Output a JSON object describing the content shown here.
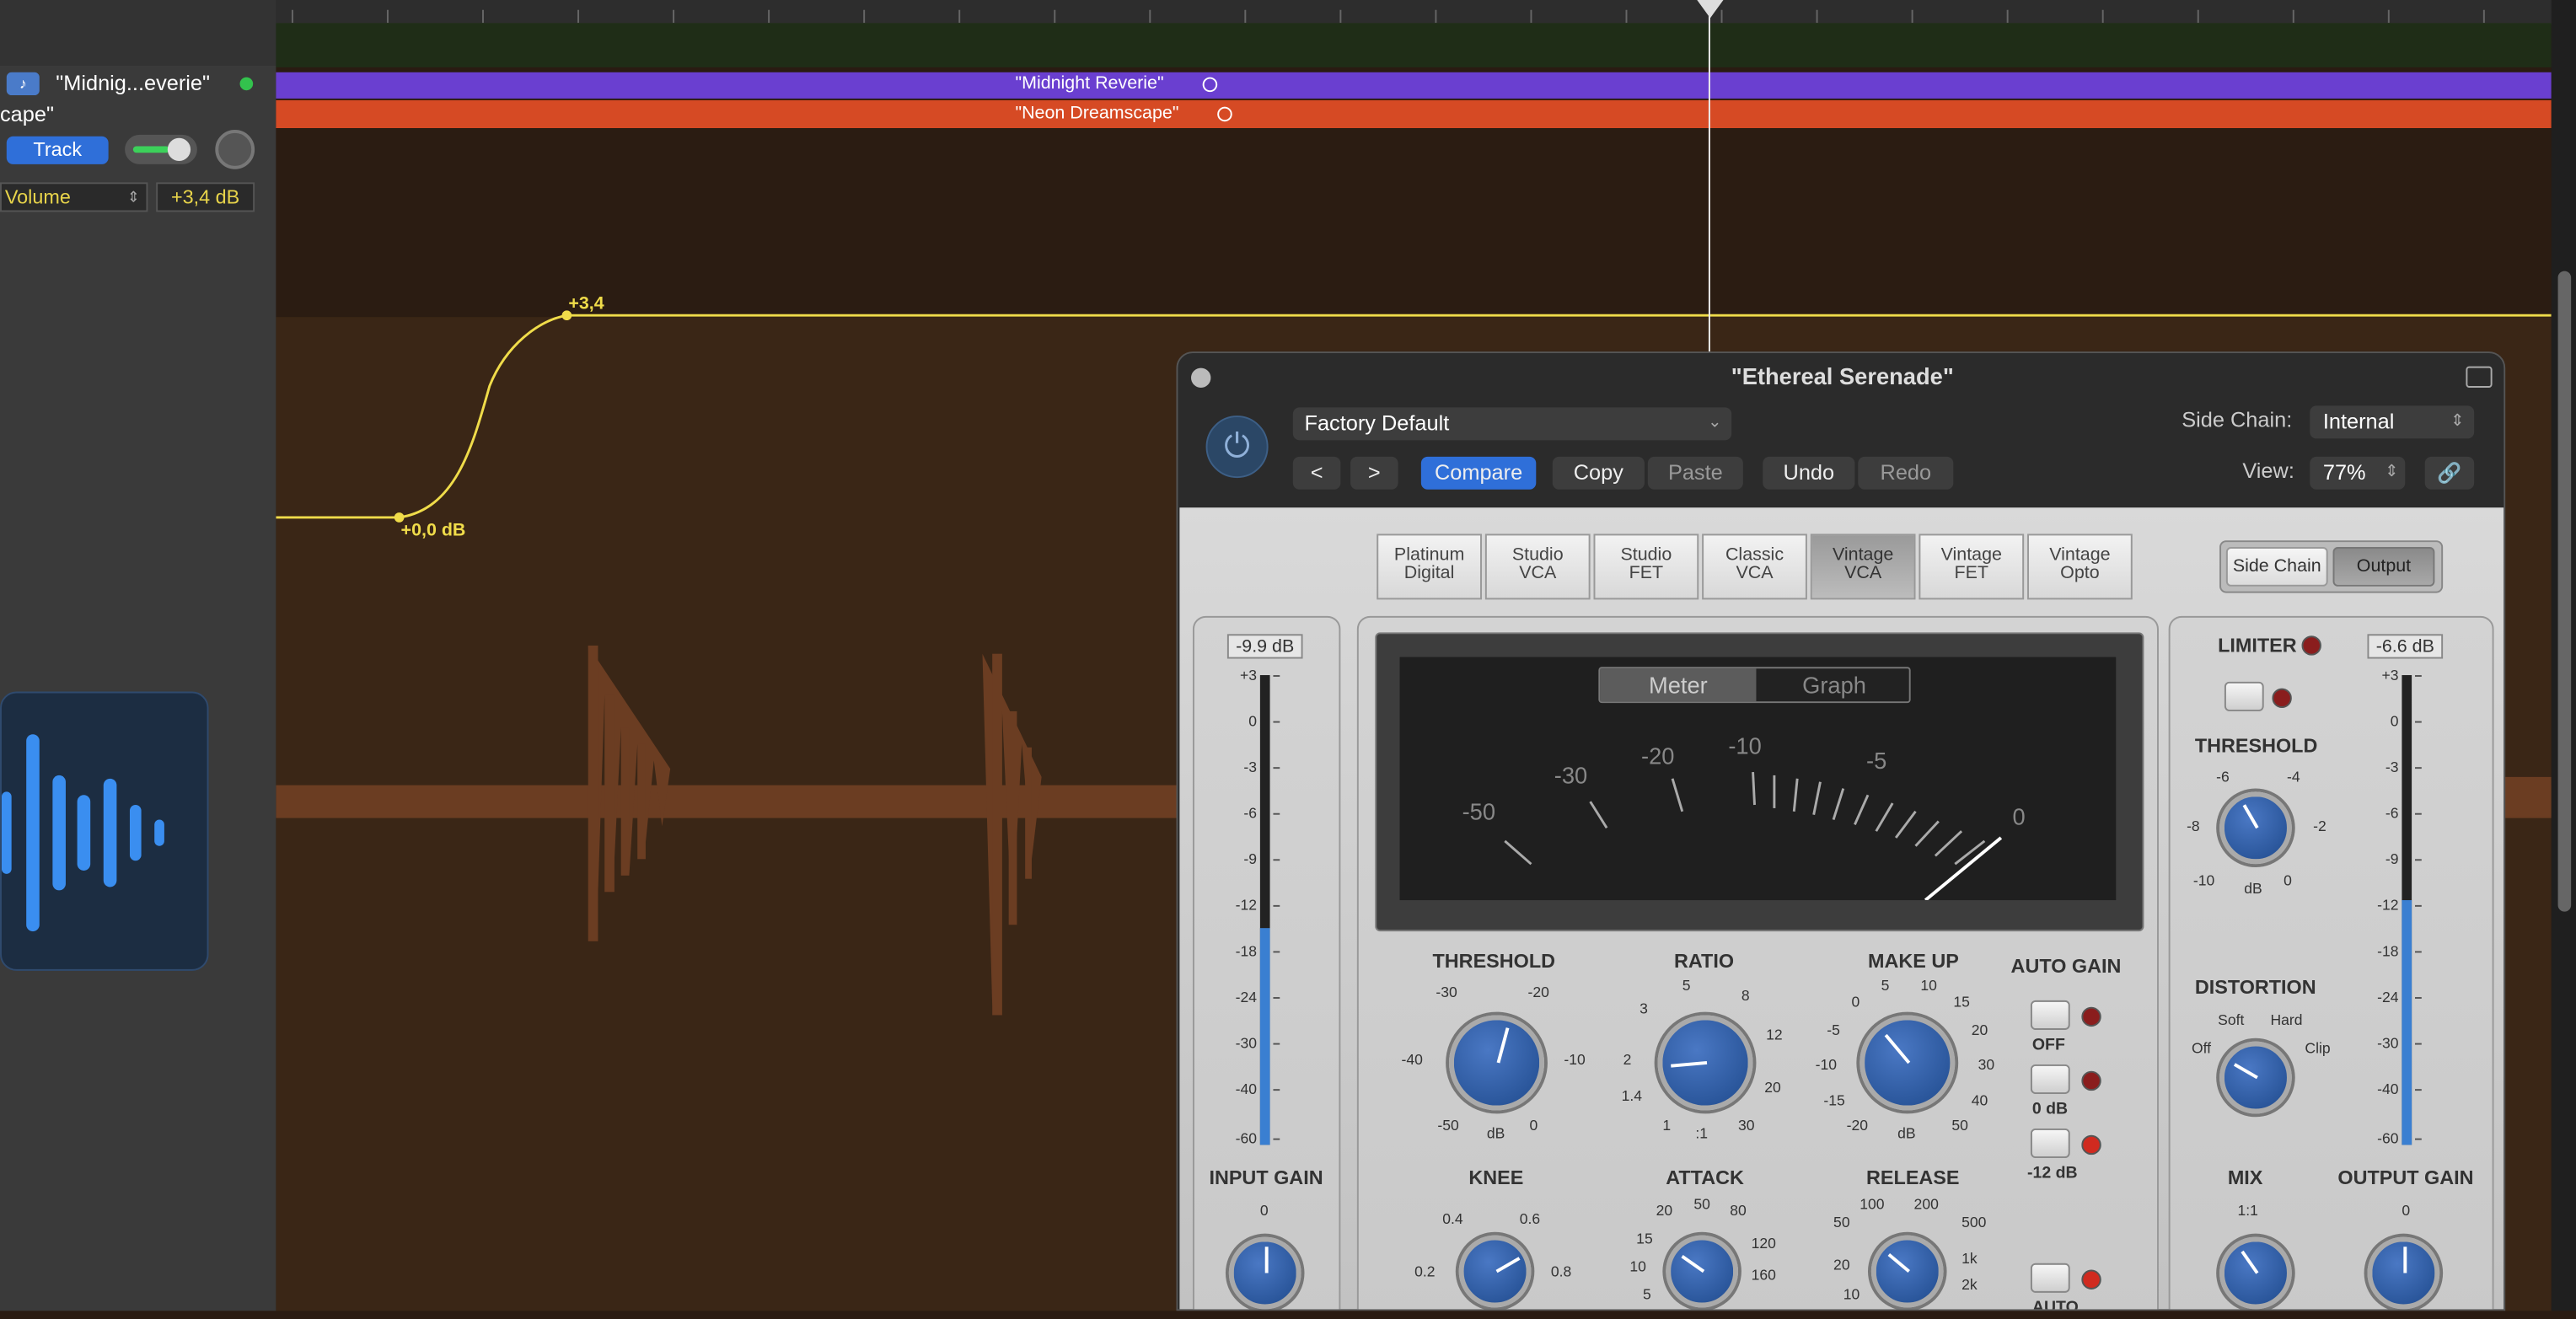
{
  "track": {
    "name": "\"Midnig...everie\"",
    "name2": "cape\"",
    "icon": "midi-track-icon",
    "track_btn": "Track",
    "automation_param": "Volume",
    "automation_value": "+3,4 dB"
  },
  "regions": [
    {
      "label": "\"Midnight Reverie\"",
      "color": "#6a3fd0"
    },
    {
      "label": "\"Neon Dreamscape\"",
      "color": "#d64a24"
    }
  ],
  "automation": {
    "start_label": "+0,0 dB",
    "end_label": "+3,4"
  },
  "plugin": {
    "title": "\"Ethereal Serenade\"",
    "preset": "Factory Default",
    "side_chain_label": "Side Chain:",
    "side_chain_value": "Internal",
    "view_label": "View:",
    "view_value": "77%",
    "buttons": {
      "compare": "Compare",
      "copy": "Copy",
      "paste": "Paste",
      "undo": "Undo",
      "redo": "Redo"
    },
    "models": [
      {
        "l1": "Platinum",
        "l2": "Digital"
      },
      {
        "l1": "Studio",
        "l2": "VCA"
      },
      {
        "l1": "Studio",
        "l2": "FET"
      },
      {
        "l1": "Classic",
        "l2": "VCA"
      },
      {
        "l1": "Vintage",
        "l2": "VCA"
      },
      {
        "l1": "Vintage",
        "l2": "FET"
      },
      {
        "l1": "Vintage",
        "l2": "Opto"
      }
    ],
    "selected_model": 4,
    "right_tabs": {
      "side_chain": "Side Chain",
      "output": "Output"
    },
    "meter_tabs": {
      "meter": "Meter",
      "graph": "Graph"
    },
    "vu_scale": [
      "-50",
      "-30",
      "-20",
      "-10",
      "-5",
      "0"
    ],
    "input": {
      "db": "-9.9 dB",
      "label": "INPUT GAIN",
      "zero": "0",
      "level": 0.46
    },
    "output": {
      "db": "-6.6 dB",
      "label": "OUTPUT GAIN",
      "zero": "0",
      "level": 0.52
    },
    "meter_scale": [
      "+3",
      "0",
      "-3",
      "-6",
      "-9",
      "-12",
      "-18",
      "-24",
      "-30",
      "-40",
      "-60"
    ],
    "threshold": {
      "label": "THRESHOLD",
      "ticks": [
        "-30",
        "-20",
        "-40",
        "-10",
        "-50",
        "0"
      ],
      "unit": "dB"
    },
    "ratio": {
      "label": "RATIO",
      "ticks": [
        "5",
        "3",
        "8",
        "2",
        "12",
        "1.4",
        "20",
        "1",
        "30"
      ],
      "unit": ":1"
    },
    "makeup": {
      "label": "MAKE UP",
      "ticks": [
        "5",
        "10",
        "0",
        "15",
        "-5",
        "20",
        "-10",
        "30",
        "-15",
        "40",
        "-20",
        "50"
      ],
      "unit": "dB"
    },
    "auto_gain": {
      "label": "AUTO GAIN",
      "off": "OFF",
      "zero": "0 dB",
      "minus12": "-12 dB",
      "auto": "AUTO"
    },
    "knee": {
      "label": "KNEE",
      "ticks": [
        "0.4",
        "0.6",
        "0.2",
        "0.8"
      ]
    },
    "attack": {
      "label": "ATTACK",
      "ticks": [
        "20",
        "50",
        "80",
        "15",
        "120",
        "10",
        "160",
        "5"
      ]
    },
    "release": {
      "label": "RELEASE",
      "ticks": [
        "100",
        "200",
        "50",
        "500",
        "20",
        "1k",
        "10",
        "2k"
      ]
    },
    "limiter": {
      "label": "LIMITER",
      "threshold": "THRESHOLD",
      "ticks": [
        "-6",
        "-4",
        "-8",
        "-2",
        "-10",
        "0"
      ],
      "unit": "dB"
    },
    "distortion": {
      "label": "DISTORTION",
      "soft": "Soft",
      "hard": "Hard",
      "off": "Off",
      "clip": "Clip"
    },
    "mix": {
      "label": "MIX",
      "tick": "1:1"
    }
  }
}
